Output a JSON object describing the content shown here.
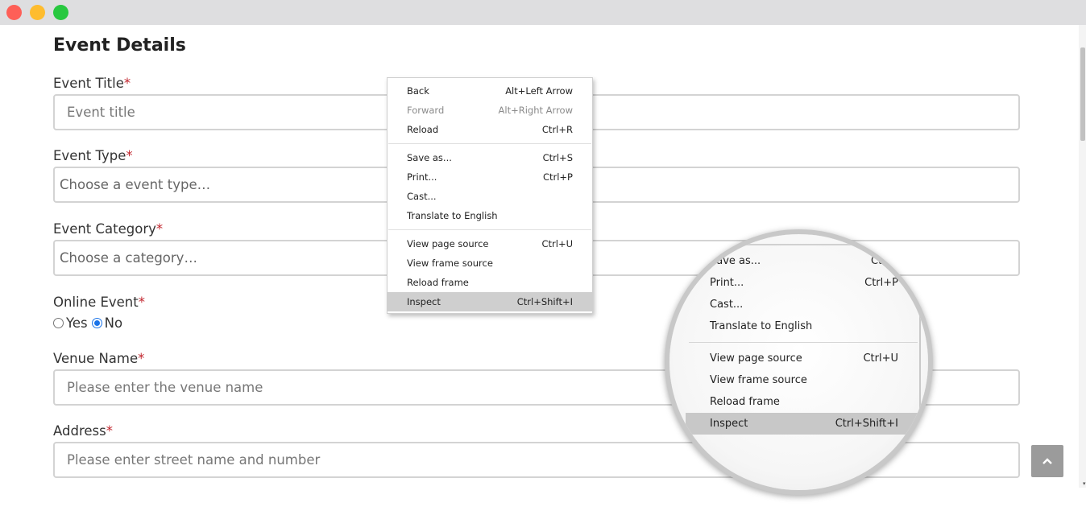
{
  "form": {
    "title": "Event Details",
    "required_mark": "*",
    "fields": {
      "event_title": {
        "label": "Event Title",
        "placeholder": "Event title"
      },
      "event_type": {
        "label": "Event Type",
        "value": "Choose a event type…"
      },
      "event_category": {
        "label": "Event Category",
        "value": "Choose a category…"
      },
      "online_event": {
        "label": "Online Event",
        "options": [
          "Yes",
          "No"
        ],
        "selected": "No"
      },
      "venue_name": {
        "label": "Venue Name",
        "placeholder": "Please enter the venue name"
      },
      "address": {
        "label": "Address",
        "placeholder": "Please enter street name and number"
      }
    }
  },
  "context_menu": {
    "items": [
      {
        "label": "Back",
        "shortcut": "Alt+Left Arrow",
        "disabled": false
      },
      {
        "label": "Forward",
        "shortcut": "Alt+Right Arrow",
        "disabled": true
      },
      {
        "label": "Reload",
        "shortcut": "Ctrl+R",
        "disabled": false
      },
      {
        "label": "Save as...",
        "shortcut": "Ctrl+S",
        "disabled": false
      },
      {
        "label": "Print...",
        "shortcut": "Ctrl+P",
        "disabled": false
      },
      {
        "label": "Cast...",
        "shortcut": "",
        "disabled": false
      },
      {
        "label": "Translate to English",
        "shortcut": "",
        "disabled": false
      },
      {
        "label": "View page source",
        "shortcut": "Ctrl+U",
        "disabled": false
      },
      {
        "label": "View frame source",
        "shortcut": "",
        "disabled": false
      },
      {
        "label": "Reload frame",
        "shortcut": "",
        "disabled": false
      },
      {
        "label": "Inspect",
        "shortcut": "Ctrl+Shift+I",
        "disabled": false,
        "highlighted": true
      }
    ]
  },
  "magnifier": {
    "items": [
      {
        "label": "Save as...",
        "shortcut": "Ctrl+"
      },
      {
        "label": "Print...",
        "shortcut": "Ctrl+P"
      },
      {
        "label": "Cast...",
        "shortcut": ""
      },
      {
        "label": "Translate to English",
        "shortcut": ""
      },
      {
        "label": "View page source",
        "shortcut": "Ctrl+U"
      },
      {
        "label": "View frame source",
        "shortcut": ""
      },
      {
        "label": "Reload frame",
        "shortcut": ""
      },
      {
        "label": "Inspect",
        "shortcut": "Ctrl+Shift+I",
        "highlighted": true
      }
    ]
  },
  "icons": {
    "back_to_top": "chevron-up-icon",
    "scroll_down": "scroll-down-arrow-icon"
  },
  "colors": {
    "required": "#c2262e",
    "radio_accent": "#1a73e8",
    "window_close": "#fe5f57",
    "window_minimize": "#febc2e",
    "window_maximize": "#28c840"
  }
}
